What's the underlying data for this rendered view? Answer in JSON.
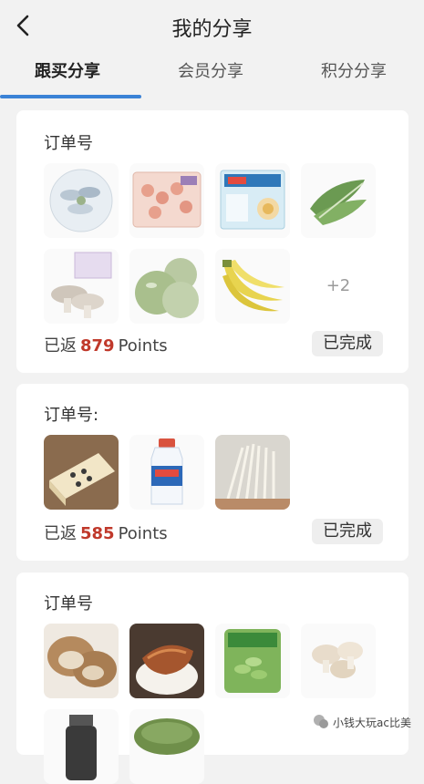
{
  "header": {
    "title": "我的分享"
  },
  "tabs": [
    {
      "label": "跟买分享",
      "active": true
    },
    {
      "label": "会员分享",
      "active": false
    },
    {
      "label": "积分分享",
      "active": false
    }
  ],
  "orders": [
    {
      "label": "订单号",
      "rebate_prefix": "已返",
      "points": "879",
      "points_unit": "Points",
      "status": "已完成",
      "more": "+2",
      "items": [
        "fish-platter",
        "shrimp-pack",
        "egg-tart-box",
        "green-vegetable",
        "mushroom-pack",
        "green-melons",
        "bananas"
      ]
    },
    {
      "label": "订单号:",
      "rebate_prefix": "已返",
      "points": "585",
      "points_unit": "Points",
      "status": "已完成",
      "items": [
        "cheese-cake",
        "milk-bottle",
        "enoki-mushrooms"
      ]
    },
    {
      "label": "订单号",
      "items": [
        "bread",
        "braised-pork-rice",
        "edamame-pack",
        "mushrooms",
        "dark-jar",
        "green-tea-leaves"
      ]
    }
  ],
  "watermark": {
    "text": "小钱大玩ac比美"
  },
  "colors": {
    "accent": "#3b82d6",
    "points": "#c0392b"
  }
}
